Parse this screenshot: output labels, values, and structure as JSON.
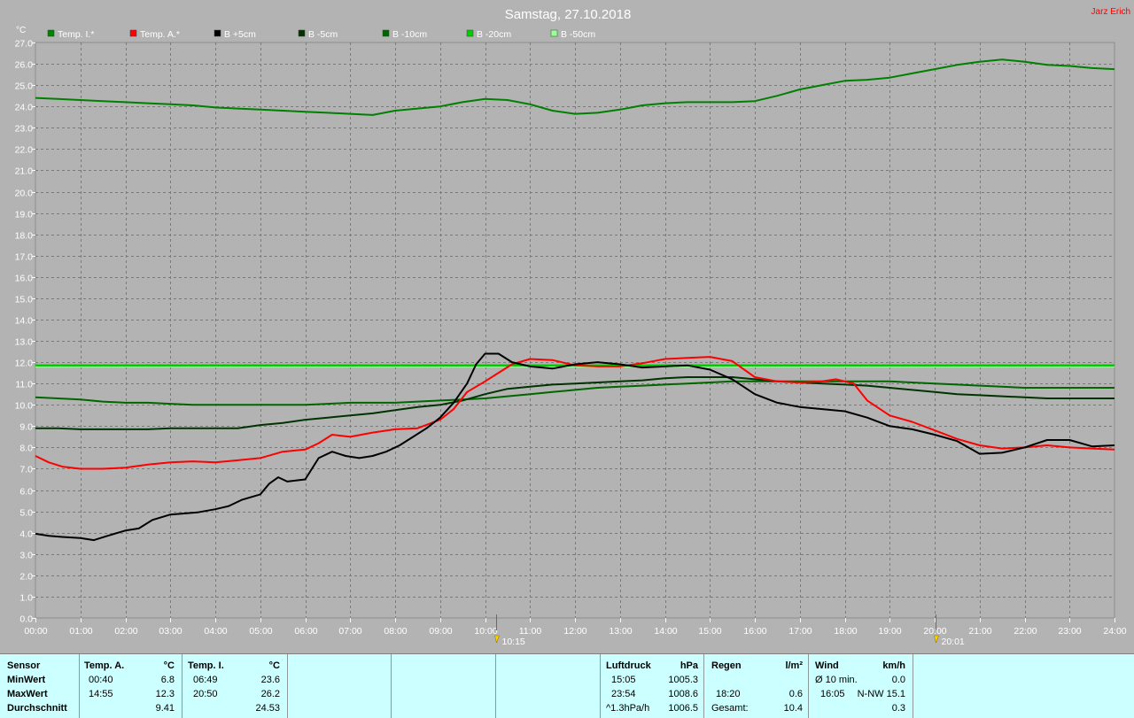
{
  "title": "Samstag, 27.10.2018",
  "author": "Jarz Erich",
  "chart_data": {
    "type": "line",
    "ylabel": "°C",
    "ylim": [
      0,
      27
    ],
    "ytick_step": 1,
    "xlim": [
      0,
      24
    ],
    "x_tick_labels": [
      "00:00",
      "01:00",
      "02:00",
      "03:00",
      "04:00",
      "05:00",
      "06:00",
      "07:00",
      "08:00",
      "09:00",
      "10:00",
      "11:00",
      "12:00",
      "13:00",
      "14:00",
      "15:00",
      "16:00",
      "17:00",
      "18:00",
      "19:00",
      "20:00",
      "21:00",
      "22:00",
      "23:00",
      "24:00"
    ],
    "grid": true,
    "legend_position": "top-left",
    "series": [
      {
        "name": "Temp. I.*",
        "color": "#008000",
        "x": [
          0,
          0.5,
          1,
          1.5,
          2,
          2.5,
          3,
          3.5,
          4,
          4.5,
          5,
          5.5,
          6,
          6.5,
          7,
          7.5,
          8,
          8.5,
          9,
          9.5,
          10,
          10.5,
          11,
          11.5,
          12,
          12.5,
          13,
          13.5,
          14,
          14.5,
          15,
          15.5,
          16,
          16.5,
          17,
          17.5,
          18,
          18.5,
          19,
          19.5,
          20,
          20.5,
          21,
          21.5,
          22,
          22.5,
          23,
          23.5,
          24
        ],
        "y": [
          24.4,
          24.35,
          24.3,
          24.25,
          24.2,
          24.15,
          24.1,
          24.05,
          23.95,
          23.9,
          23.85,
          23.8,
          23.75,
          23.7,
          23.65,
          23.6,
          23.8,
          23.9,
          24.0,
          24.2,
          24.35,
          24.3,
          24.1,
          23.8,
          23.65,
          23.7,
          23.85,
          24.05,
          24.15,
          24.2,
          24.2,
          24.2,
          24.25,
          24.5,
          24.8,
          25.0,
          25.2,
          25.25,
          25.35,
          25.55,
          25.75,
          25.95,
          26.1,
          26.2,
          26.1,
          25.95,
          25.9,
          25.8,
          25.75
        ]
      },
      {
        "name": "Temp. A.*",
        "color": "#ff0000",
        "x": [
          0,
          0.3,
          0.6,
          1,
          1.5,
          2,
          2.5,
          3,
          3.5,
          4,
          4.5,
          5,
          5.5,
          6,
          6.3,
          6.6,
          7,
          7.5,
          8,
          8.5,
          9,
          9.3,
          9.6,
          10,
          10.3,
          10.6,
          11,
          11.5,
          12,
          12.5,
          13,
          13.5,
          14,
          14.5,
          15,
          15.5,
          16,
          16.5,
          17,
          17.5,
          17.8,
          18.2,
          18.5,
          19,
          19.5,
          20,
          20.5,
          21,
          21.5,
          22,
          22.5,
          23,
          23.5,
          24
        ],
        "y": [
          7.6,
          7.3,
          7.1,
          7.0,
          7.0,
          7.05,
          7.2,
          7.3,
          7.35,
          7.3,
          7.4,
          7.5,
          7.8,
          7.9,
          8.2,
          8.6,
          8.5,
          8.7,
          8.85,
          8.9,
          9.3,
          9.8,
          10.6,
          11.1,
          11.5,
          11.9,
          12.15,
          12.1,
          11.85,
          11.8,
          11.8,
          11.95,
          12.15,
          12.2,
          12.25,
          12.05,
          11.3,
          11.1,
          11.05,
          11.1,
          11.2,
          11.0,
          10.2,
          9.5,
          9.2,
          8.8,
          8.4,
          8.1,
          7.95,
          8.0,
          8.1,
          8.0,
          7.95,
          7.9
        ]
      },
      {
        "name": "B +5cm",
        "color": "#000000",
        "x": [
          0,
          0.3,
          0.6,
          1,
          1.3,
          1.6,
          2,
          2.3,
          2.6,
          3,
          3.3,
          3.6,
          4,
          4.3,
          4.6,
          5,
          5.2,
          5.4,
          5.6,
          6,
          6.3,
          6.6,
          6.9,
          7.2,
          7.5,
          7.8,
          8.1,
          8.4,
          8.7,
          9,
          9.3,
          9.6,
          9.8,
          10,
          10.3,
          10.6,
          11,
          11.5,
          12,
          12.5,
          13,
          13.5,
          14,
          14.5,
          15,
          15.5,
          16,
          16.5,
          17,
          17.5,
          18,
          18.5,
          19,
          19.5,
          20,
          20.5,
          21,
          21.5,
          22,
          22.5,
          23,
          23.5,
          24
        ],
        "y": [
          3.95,
          3.85,
          3.8,
          3.75,
          3.65,
          3.85,
          4.1,
          4.2,
          4.6,
          4.85,
          4.9,
          4.95,
          5.1,
          5.25,
          5.55,
          5.8,
          6.3,
          6.6,
          6.4,
          6.5,
          7.5,
          7.8,
          7.6,
          7.5,
          7.6,
          7.8,
          8.1,
          8.5,
          8.9,
          9.4,
          10.1,
          11.0,
          11.9,
          12.4,
          12.4,
          12.0,
          11.8,
          11.7,
          11.9,
          12.0,
          11.9,
          11.75,
          11.8,
          11.85,
          11.65,
          11.2,
          10.5,
          10.1,
          9.9,
          9.8,
          9.7,
          9.4,
          9.0,
          8.85,
          8.6,
          8.3,
          7.7,
          7.75,
          8.0,
          8.35,
          8.35,
          8.05,
          8.1
        ]
      },
      {
        "name": "B -5cm",
        "color": "#003300",
        "x": [
          0,
          0.5,
          1,
          1.5,
          2,
          2.5,
          3,
          3.5,
          4,
          4.5,
          5,
          5.5,
          6,
          6.5,
          7,
          7.5,
          8,
          8.5,
          9,
          9.5,
          10,
          10.5,
          11,
          11.5,
          12,
          12.5,
          13,
          13.5,
          14,
          14.5,
          15,
          15.5,
          16,
          16.5,
          17,
          17.5,
          18,
          18.5,
          19,
          19.5,
          20,
          20.5,
          21,
          21.5,
          22,
          22.5,
          23,
          23.5,
          24
        ],
        "y": [
          8.9,
          8.9,
          8.85,
          8.85,
          8.85,
          8.85,
          8.9,
          8.9,
          8.9,
          8.9,
          9.05,
          9.15,
          9.3,
          9.4,
          9.5,
          9.6,
          9.75,
          9.9,
          10.0,
          10.2,
          10.5,
          10.75,
          10.85,
          10.95,
          11.0,
          11.05,
          11.1,
          11.15,
          11.25,
          11.3,
          11.3,
          11.3,
          11.2,
          11.1,
          11.05,
          11.0,
          10.95,
          10.9,
          10.8,
          10.7,
          10.6,
          10.5,
          10.45,
          10.4,
          10.35,
          10.3,
          10.3,
          10.3,
          10.3
        ]
      },
      {
        "name": "B -10cm",
        "color": "#006600",
        "x": [
          0,
          0.5,
          1,
          1.5,
          2,
          2.5,
          3,
          3.5,
          4,
          4.5,
          5,
          5.5,
          6,
          6.5,
          7,
          7.5,
          8,
          8.5,
          9,
          9.5,
          10,
          10.5,
          11,
          11.5,
          12,
          12.5,
          13,
          13.5,
          14,
          14.5,
          15,
          15.5,
          16,
          16.5,
          17,
          17.5,
          18,
          18.5,
          19,
          19.5,
          20,
          20.5,
          21,
          21.5,
          22,
          22.5,
          23,
          23.5,
          24
        ],
        "y": [
          10.35,
          10.3,
          10.25,
          10.15,
          10.1,
          10.1,
          10.05,
          10.0,
          10.0,
          10.0,
          10.0,
          10.0,
          10.0,
          10.05,
          10.1,
          10.1,
          10.1,
          10.15,
          10.2,
          10.25,
          10.3,
          10.4,
          10.5,
          10.6,
          10.7,
          10.8,
          10.85,
          10.9,
          10.95,
          11.0,
          11.05,
          11.1,
          11.1,
          11.1,
          11.1,
          11.1,
          11.1,
          11.1,
          11.1,
          11.05,
          11.0,
          10.95,
          10.9,
          10.85,
          10.8,
          10.8,
          10.8,
          10.8,
          10.8
        ]
      },
      {
        "name": "B -20cm",
        "color": "#00cc00",
        "x": [
          0,
          24
        ],
        "y": [
          11.85,
          11.85
        ]
      },
      {
        "name": "B -50cm",
        "color": "#99ff99",
        "x": [
          0,
          24
        ],
        "y": [
          11.8,
          11.8
        ]
      }
    ],
    "events": [
      {
        "label": "10:15",
        "x": 10.25
      },
      {
        "label": "20:01",
        "x": 20.02
      }
    ]
  },
  "stats": {
    "sensor": {
      "header": "Sensor",
      "rows": [
        "MinWert",
        "MaxWert",
        "Durchschnitt"
      ]
    },
    "temp_a": {
      "header": "Temp. A.",
      "unit": "°C",
      "min_time": "00:40",
      "min_val": "6.8",
      "max_time": "14:55",
      "max_val": "12.3",
      "avg": "9.41"
    },
    "temp_i": {
      "header": "Temp. I.",
      "unit": "°C",
      "min_time": "06:49",
      "min_val": "23.6",
      "max_time": "20:50",
      "max_val": "26.2",
      "avg": "24.53"
    },
    "pressure": {
      "header": "Luftdruck",
      "unit": "hPa",
      "min_time": "15:05",
      "min_val": "1005.3",
      "max_time": "23:54",
      "max_val": "1008.6",
      "trend_label": "^1.3hPa/h",
      "trend_val": "1006.5"
    },
    "rain": {
      "header": "Regen",
      "unit": "l/m²",
      "max_time": "18:20",
      "max_val": "0.6",
      "total_label": "Gesamt:",
      "total_val": "10.4"
    },
    "wind": {
      "header": "Wind",
      "unit": "km/h",
      "avg_label": "Ø 10 min.",
      "avg_val": "0.0",
      "max_time": "16:05",
      "max_val": "N-NW 15.1",
      "mean_val": "0.3"
    }
  }
}
